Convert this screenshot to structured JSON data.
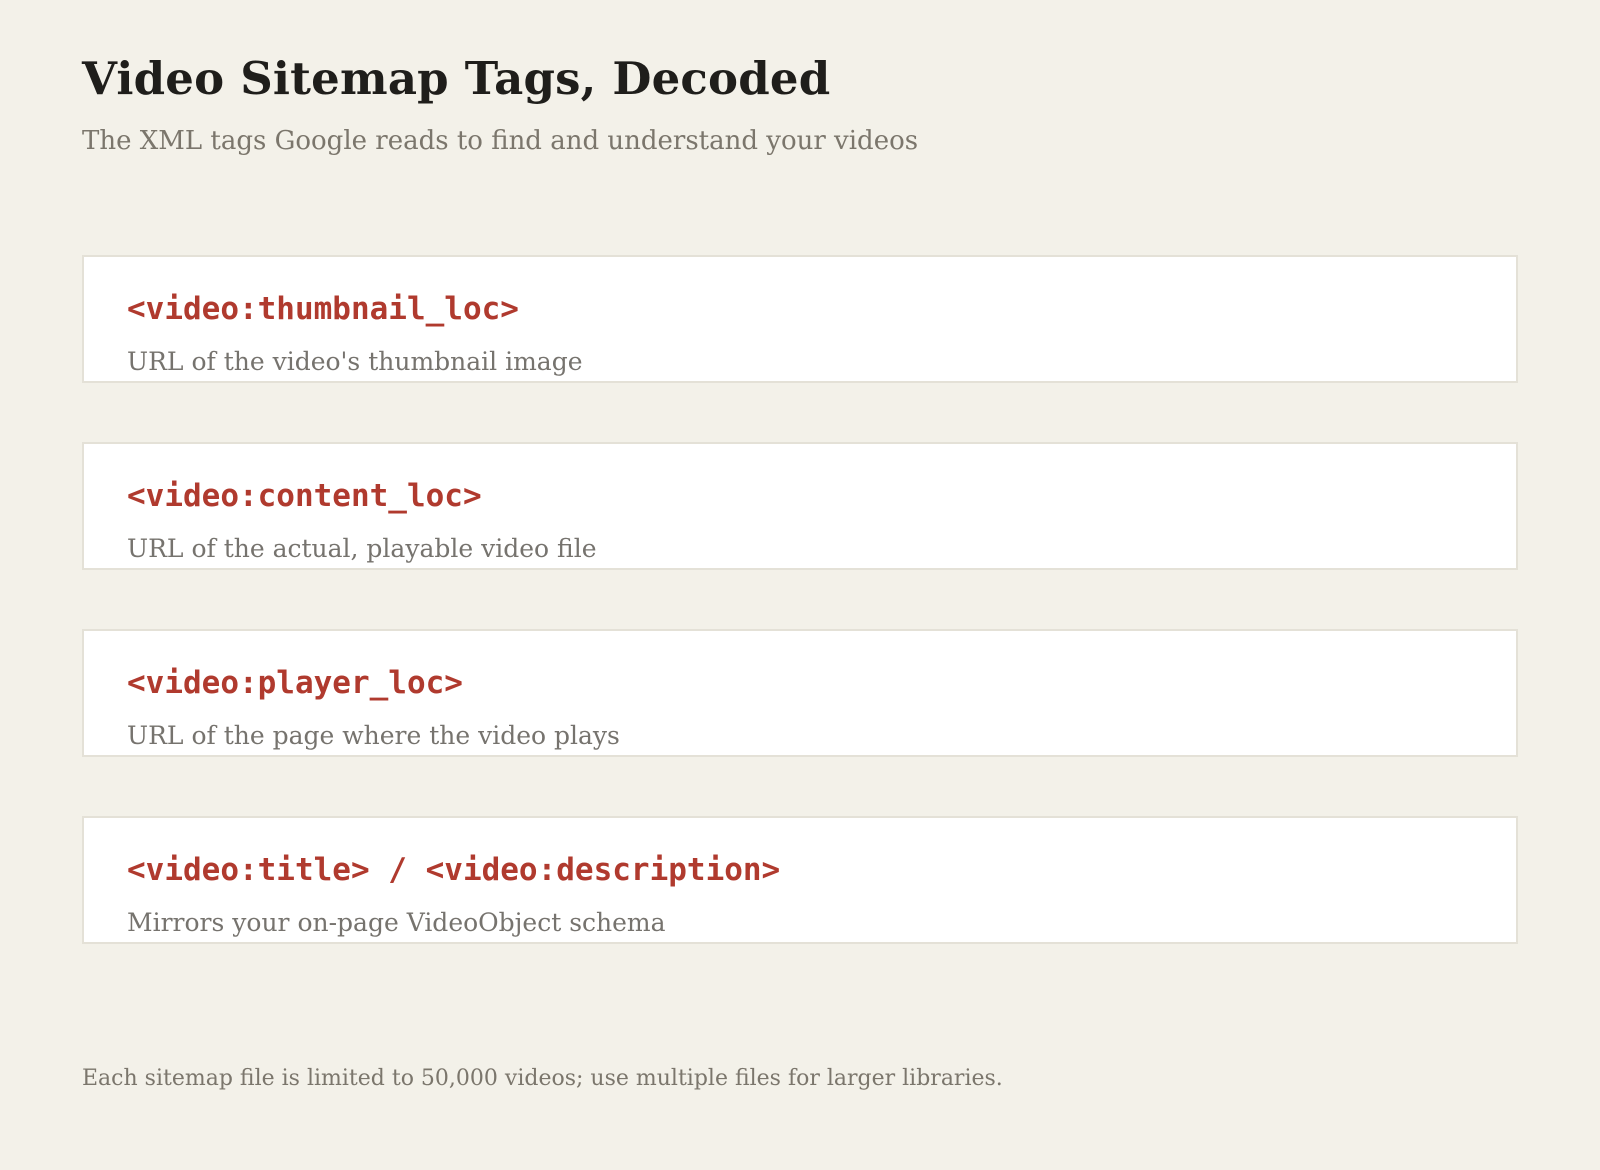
{
  "header": {
    "title": "Video Sitemap Tags, Decoded",
    "subtitle": "The XML tags Google reads to find and understand your videos"
  },
  "tags": [
    {
      "tag": "<video:thumbnail_loc>",
      "description": "URL of the video's thumbnail image"
    },
    {
      "tag": "<video:content_loc>",
      "description": "URL of the actual, playable video file"
    },
    {
      "tag": "<video:player_loc>",
      "description": "URL of the page where the video plays"
    },
    {
      "tag": "<video:title> / <video:description>",
      "description": "Mirrors your on-page VideoObject schema"
    }
  ],
  "footer": {
    "note": "Each sitemap file is limited to 50,000 videos; use multiple files for larger libraries."
  },
  "colors": {
    "background": "#f3f1e9",
    "tag_accent": "#b03a2e",
    "muted_text": "#76736e",
    "card_border": "#e4e1d7"
  }
}
